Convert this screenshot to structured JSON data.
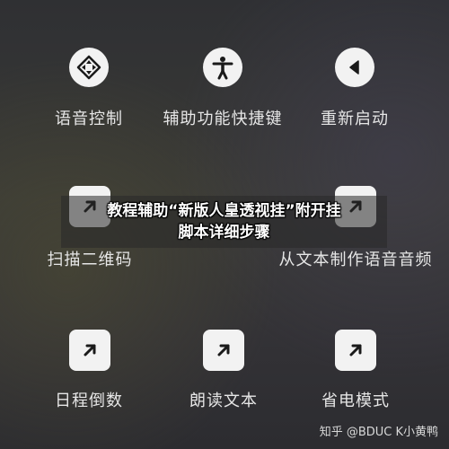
{
  "grid": {
    "row1": [
      {
        "label": "语音控制",
        "icon": "voice-control-icon"
      },
      {
        "label": "辅助功能快捷键",
        "icon": "accessibility-icon"
      },
      {
        "label": "重新启动",
        "icon": "restart-icon"
      }
    ],
    "row2": [
      {
        "label": "扫描二维码",
        "icon": "arrow-up-right-icon"
      },
      {
        "label": "从文本制作语音音频",
        "icon": "arrow-up-right-icon"
      }
    ],
    "row3": [
      {
        "label": "日程倒数",
        "icon": "arrow-up-right-icon"
      },
      {
        "label": "朗读文本",
        "icon": "arrow-up-right-icon"
      },
      {
        "label": "省电模式",
        "icon": "arrow-up-right-icon"
      }
    ]
  },
  "banner": {
    "line1": "教程辅助“新版人皇透视挂”附开挂",
    "line2": "脚本详细步骤"
  },
  "watermark": "知乎 @BDUC K小黄鸭",
  "colors": {
    "icon_bg": "#f2f2f2",
    "icon_fg": "#1a1a1a",
    "label": "#e6e6e6"
  }
}
